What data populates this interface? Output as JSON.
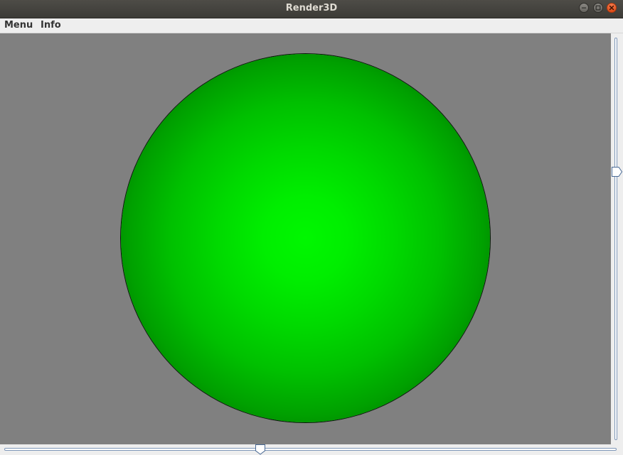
{
  "window": {
    "title": "Render3D"
  },
  "menubar": {
    "items": [
      {
        "label": "Menu"
      },
      {
        "label": "Info"
      }
    ]
  },
  "canvas": {
    "background_color": "#808080",
    "object": "sphere",
    "object_color": "#00ff00"
  },
  "sliders": {
    "vertical": {
      "orientation": "vertical",
      "value_fraction": 0.34
    },
    "horizontal": {
      "orientation": "horizontal",
      "value_fraction": 0.42
    }
  },
  "icons": {
    "minimize": "minimize-icon",
    "maximize": "maximize-icon",
    "close": "close-icon"
  },
  "colors": {
    "titlebar": "#3c3b37",
    "close_button": "#e95420",
    "slider_track_border": "#7e97b8"
  }
}
